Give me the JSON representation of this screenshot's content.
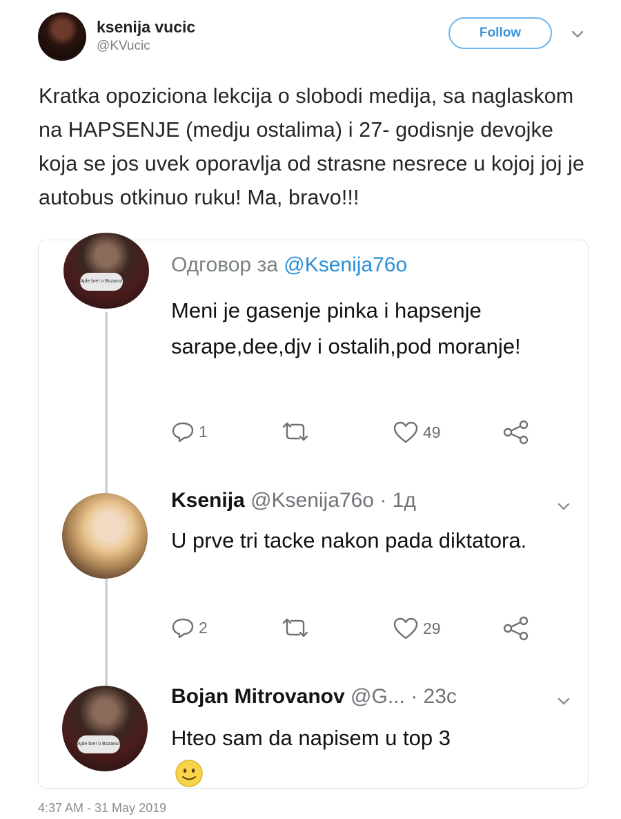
{
  "author": {
    "name": "ksenija vucic",
    "handle": "@KVucic",
    "follow_label": "Follow",
    "avatar": "author-avatar"
  },
  "tweet": {
    "text": "Kratka opoziciona lekcija o slobodi medija, sa naglaskom na HAPSENJE (medju ostalima) i 27- godisnje devojke koja se jos uvek oporavlja od strasne nesrece u kojoj joj je autobus otkinuo ruku! Ma, bravo!!!",
    "timestamp": "4:37 AM - 31 May 2019"
  },
  "embedded": {
    "reply1": {
      "reply_prefix": "Одговор за",
      "reply_mention": "@Ksenija76o",
      "text": "Meni je gasenje pinka i hapsenje sarape,dee,djv i ostalih,pod moranje!",
      "avatar_caption": "Ajde bre! o Bozanu!",
      "replies": "1",
      "retweets": "",
      "likes": "49"
    },
    "reply2": {
      "name": "Ksenija",
      "handle": "@Ksenija76o",
      "time": "· 1д",
      "text": "U prve tri tacke nakon pada diktatora.",
      "replies": "2",
      "retweets": "",
      "likes": "29"
    },
    "reply3": {
      "name": "Bojan Mitrovanov",
      "handle": "@G...",
      "time": "· 23c",
      "text": "Hteo sam da napisem u top 3",
      "avatar_caption": "Ajde bre! o Bozanu!",
      "emoji": "slightly-smiling-face-emoji"
    }
  },
  "icons": {
    "reply": "reply-icon",
    "retweet": "retweet-icon",
    "like": "heart-icon",
    "share": "share-icon",
    "caret": "chevron-down-icon"
  },
  "colors": {
    "follow_border": "#6fb6ec",
    "follow_text": "#3b94d9",
    "mention": "#2a8fd6",
    "muted": "#7b8084",
    "thread_line": "#cdd3d8"
  }
}
